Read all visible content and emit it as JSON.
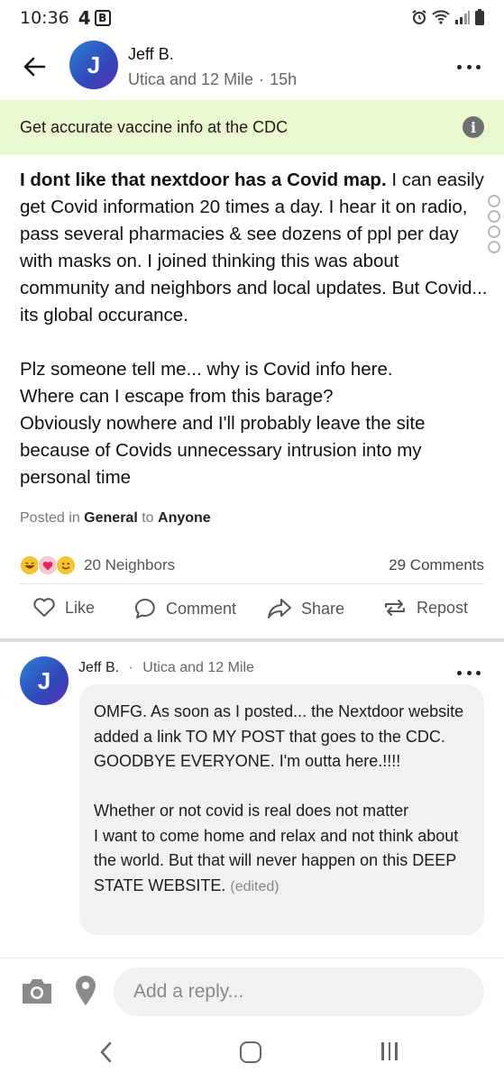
{
  "status_bar": {
    "time": "10:36",
    "notif_count": "4",
    "notif_app": "B"
  },
  "post_header": {
    "avatar_letter": "J",
    "author": "Jeff B.",
    "neighborhood": "Utica and 12 Mile",
    "separator": "·",
    "age": "15h"
  },
  "banner": {
    "text": "Get accurate vaccine info at the CDC",
    "icon": "info-icon"
  },
  "post": {
    "lead": "I dont like that nextdoor has a Covid map.",
    "p1_rest": " I can easily get Covid information 20 times a day. I hear it on radio, pass several pharmacies & see dozens of ppl per day with masks on.  I joined thinking this was about community and neighbors and local updates.  But Covid...  its global occurance.",
    "p2": "Plz someone tell me... why is Covid info here.",
    "p3": "Where can I escape from this barage?",
    "p4": "Obviously nowhere and I'll probably leave the site because of Covids unnecessary intrusion into my personal time",
    "posted_in_prefix": "Posted in",
    "category": "General",
    "to_word": "to",
    "audience": "Anyone"
  },
  "engagement": {
    "neighbors": "20 Neighbors",
    "comments": "29 Comments"
  },
  "actions": {
    "like": "Like",
    "comment": "Comment",
    "share": "Share",
    "repost": "Repost"
  },
  "reply": {
    "avatar_letter": "J",
    "author": "Jeff B.",
    "separator": "·",
    "neighborhood": "Utica and 12 Mile",
    "line1": "OMFG.  As soon as I posted... the Nextdoor website added a link TO MY POST that goes to the CDC.",
    "line2": "GOODBYE EVERYONE.  I'm outta here.!!!!",
    "line3": "Whether or not covid is real does not matter",
    "line4": "I want to come home and relax and not think about the world. But that will never happen on this DEEP STATE WEBSITE.",
    "edited": "(edited)"
  },
  "composer": {
    "placeholder": "Add a reply..."
  },
  "colors": {
    "banner_bg": "#e9f8cf",
    "avatar_gradient_start": "#2c7fd6",
    "avatar_gradient_end": "#5a2fb3",
    "bubble_bg": "#f1f1f1"
  }
}
